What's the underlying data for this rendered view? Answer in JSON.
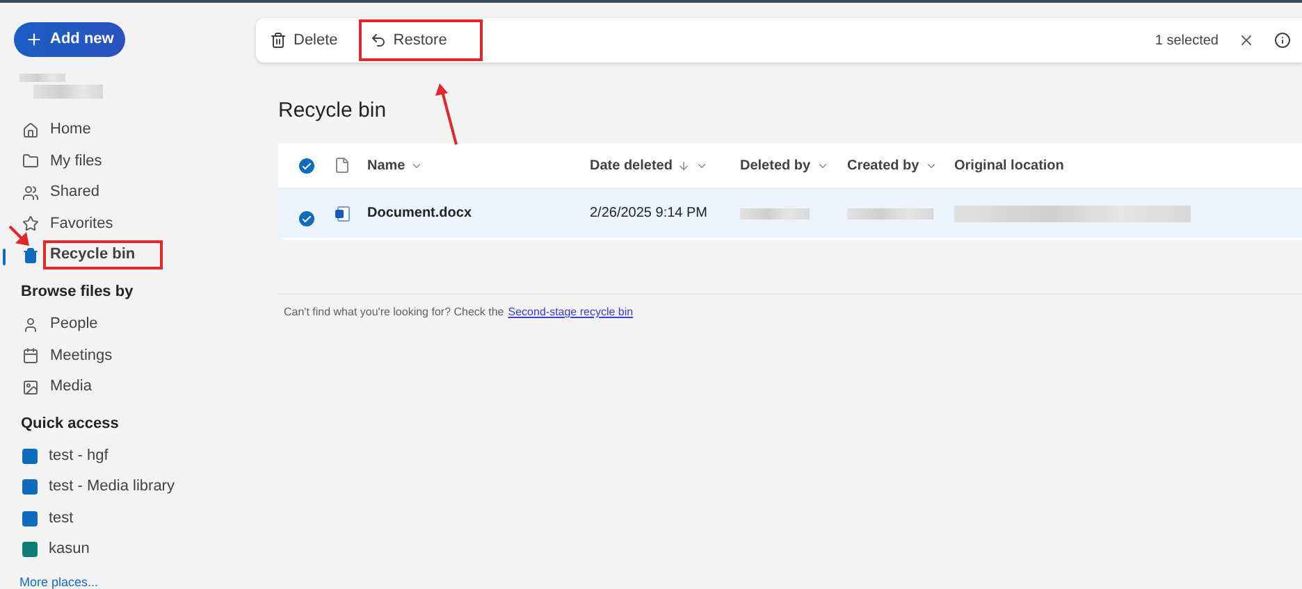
{
  "sidebar": {
    "add_button": "Add new",
    "nav": [
      {
        "label": "Home",
        "selected": false,
        "highlighted": false
      },
      {
        "label": "My files",
        "selected": false,
        "highlighted": false
      },
      {
        "label": "Shared",
        "selected": false,
        "highlighted": false
      },
      {
        "label": "Favorites",
        "selected": false,
        "highlighted": false
      },
      {
        "label": "Recycle bin",
        "selected": true,
        "highlighted": true
      }
    ],
    "browse": {
      "heading": "Browse files by",
      "items": [
        {
          "label": "People"
        },
        {
          "label": "Meetings"
        },
        {
          "label": "Media"
        }
      ]
    },
    "quick_access": {
      "heading": "Quick access",
      "items": [
        {
          "label": "test - hgf",
          "color": "#0f6cbd"
        },
        {
          "label": "test - Media library",
          "color": "#0f6cbd"
        },
        {
          "label": "test",
          "color": "#0f6cbd"
        },
        {
          "label": "kasun",
          "color": "#107c76"
        }
      ],
      "more": "More places..."
    }
  },
  "toolbar": {
    "actions": [
      {
        "label": "Delete",
        "highlighted": false
      },
      {
        "label": "Restore",
        "highlighted": true
      }
    ],
    "selection": "1 selected"
  },
  "page_title": "Recycle bin",
  "table": {
    "all_checked": true,
    "columns": [
      {
        "label": "Name",
        "sorted": false
      },
      {
        "label": "Date deleted",
        "sorted": true
      },
      {
        "label": "Deleted by",
        "sorted": false
      },
      {
        "label": "Created by",
        "sorted": false
      },
      {
        "label": "Original location",
        "sorted": false
      }
    ],
    "rows": [
      {
        "name": "Document.docx",
        "date_deleted": "2/26/2025 9:14 PM",
        "selected": true
      }
    ]
  },
  "footer": {
    "text": "Can't find what you're looking for? Check the",
    "link": "Second-stage recycle bin"
  }
}
